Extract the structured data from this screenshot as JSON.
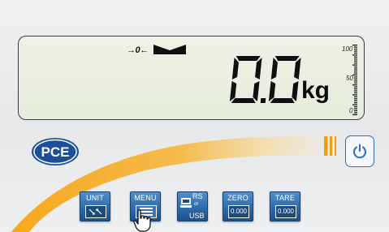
{
  "display": {
    "zero_indicator": "→0←",
    "weight": "0.0",
    "unit": "kg",
    "scale": {
      "max": "100",
      "mid": "50",
      "min": "0"
    }
  },
  "brand": {
    "logo_text": "PCE"
  },
  "keys": {
    "unit": {
      "label": "UNIT"
    },
    "menu": {
      "label": "MENU"
    },
    "rs": {
      "label_top": "RS",
      "label_or": "or",
      "label_bottom": "USB"
    },
    "zero": {
      "label": "ZERO",
      "value": "0.000"
    },
    "tare": {
      "label": "TARE",
      "value": "0.000"
    }
  },
  "colors": {
    "accent_orange": "#f39a12",
    "key_blue": "#2f6aab",
    "power_blue": "#2a6fb8",
    "logo_blue": "#1b4f9c"
  },
  "icons": {
    "power": "power-icon",
    "stable": "stable-indicator-icon",
    "cursor": "hand-cursor-icon"
  }
}
